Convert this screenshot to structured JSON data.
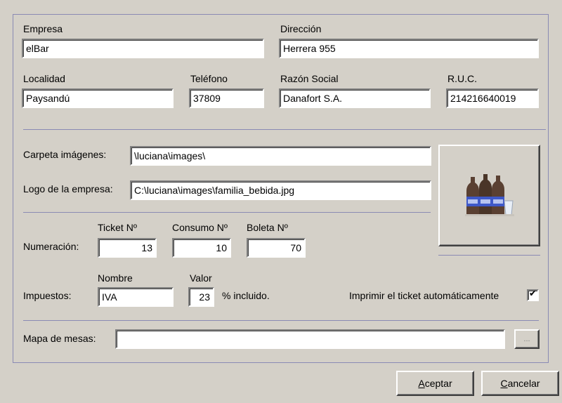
{
  "form": {
    "empresa": {
      "label": "Empresa",
      "value": "elBar"
    },
    "direccion": {
      "label": "Dirección",
      "value": "Herrera 955"
    },
    "localidad": {
      "label": "Localidad",
      "value": "Paysandú"
    },
    "telefono": {
      "label": "Teléfono",
      "value": "37809"
    },
    "razon_social": {
      "label": "Razón Social",
      "value": "Danafort S.A."
    },
    "ruc": {
      "label": "R.U.C.",
      "value": "214216640019"
    },
    "carpeta_imagenes": {
      "label": "Carpeta imágenes:",
      "value": "\\luciana\\images\\"
    },
    "logo_empresa": {
      "label": "Logo de la empresa:",
      "value": "C:\\luciana\\images\\familia_bebida.jpg"
    },
    "numeracion": {
      "label": "Numeración:",
      "ticket": {
        "label": "Ticket Nº",
        "value": "13"
      },
      "consumo": {
        "label": "Consumo Nº",
        "value": "10"
      },
      "boleta": {
        "label": "Boleta Nº",
        "value": "70"
      }
    },
    "impuestos": {
      "label": "Impuestos:",
      "nombre": {
        "label": "Nombre",
        "value": "IVA"
      },
      "valor": {
        "label": "Valor",
        "value": "23"
      },
      "suffix": "% incluido."
    },
    "imprimir_ticket": {
      "label": "Imprimir el ticket automáticamente",
      "checked": true,
      "mark": "✔"
    },
    "mapa_mesas": {
      "label": "Mapa de mesas:",
      "value": "",
      "browse_label": "..."
    }
  },
  "buttons": {
    "aceptar": {
      "mnemonic": "A",
      "rest": "ceptar"
    },
    "cancelar": {
      "mnemonic": "C",
      "rest": "ancelar"
    }
  },
  "logo_image": "bottles-icon",
  "colors": {
    "background": "#d4d0c8",
    "divider": "#8a8ab4",
    "field": "#ffffff"
  }
}
